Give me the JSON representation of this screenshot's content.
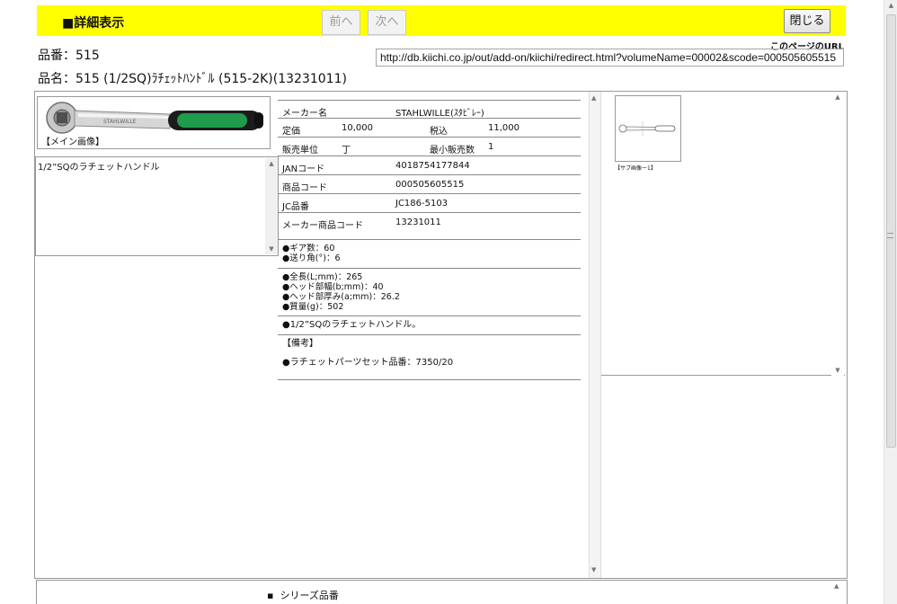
{
  "header": {
    "title": "■詳細表示",
    "prev_label": "前へ",
    "next_label": "次へ",
    "close_label": "閉じる"
  },
  "product": {
    "hinban": "品番：515",
    "hinmei": "品名：515 (1/2SQ)ﾗﾁｪｯﾄﾊﾝﾄﾞﾙ (515-2K)(13231011)",
    "url_label": "このページのURL",
    "url": "http://db.kiichi.co.jp/out/add-on/kiichi/redirect.html?volumeName=00002&scode=000505605515"
  },
  "main_image": {
    "caption": "【メイン画像】"
  },
  "description": "1/2”SQのラチェットハンドル",
  "spec": {
    "maker_label": "メーカー名",
    "maker": "STAHLWILLE(ｽﾀﾋﾞﾚｰ)",
    "price_label": "定価",
    "price": "10,000",
    "tax_label": "税込",
    "tax": "11,000",
    "unit_label": "販売単位",
    "unit": "丁",
    "min_label": "最小販売数",
    "min": "1",
    "jan_label": "JANコード",
    "jan": "4018754177844",
    "code_label": "商品コード",
    "code": "000505605515",
    "jc_label": "JC品番",
    "jc": "JC186-5103",
    "maker_code_label": "メーカー商品コード",
    "maker_code": "13231011"
  },
  "features1": [
    "●ギア数：60",
    "●送り角(°)：6"
  ],
  "features2": [
    "●全長(L;mm)：265",
    "●ヘッド部幅(b;mm)：40",
    "●ヘッド部厚み(a;mm)：26.2",
    "●質量(g)：502"
  ],
  "features3": "●1/2”SQのラチェットハンドル。",
  "remarks_label": "【備考】",
  "remarks": "●ラチェットパーツセット品番：7350/20",
  "sub_image": {
    "caption": "【サブ画像ー1】"
  },
  "series_label": "シリーズ品番",
  "colors": {
    "header_bg": "#ffff00",
    "handle_green": "#1f9b4c"
  }
}
